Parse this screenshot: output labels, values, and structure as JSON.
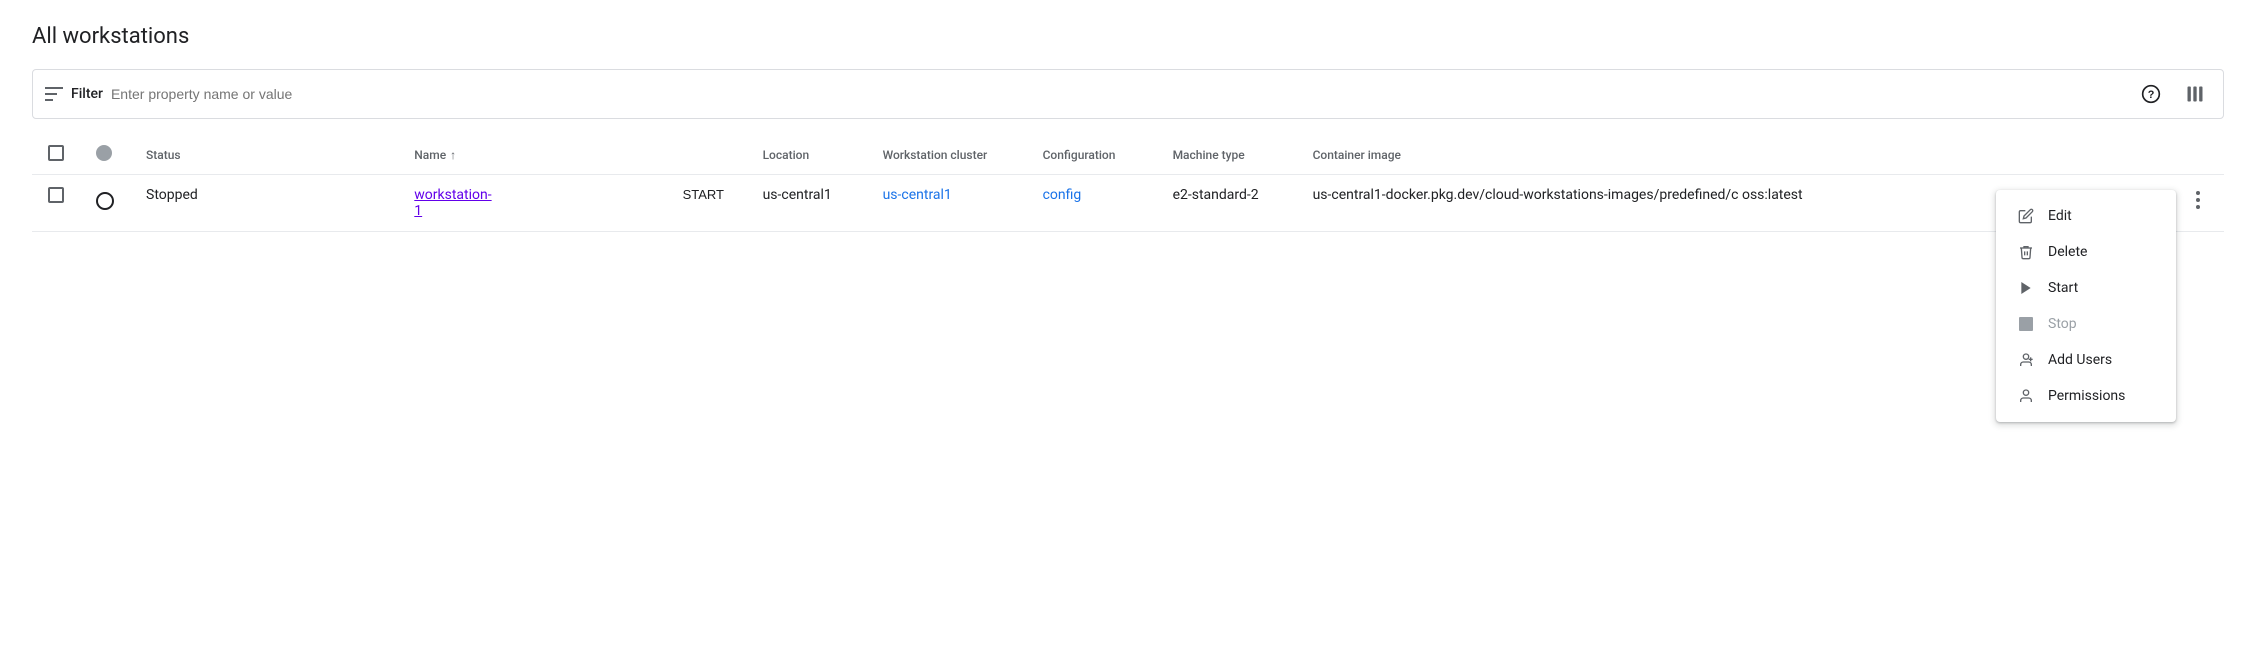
{
  "page": {
    "title": "All workstations"
  },
  "toolbar": {
    "filter_label": "Filter",
    "filter_placeholder": "Enter property name or value"
  },
  "table": {
    "columns": [
      {
        "key": "checkbox",
        "label": ""
      },
      {
        "key": "status_icon",
        "label": ""
      },
      {
        "key": "status",
        "label": "Status"
      },
      {
        "key": "name",
        "label": "Name"
      },
      {
        "key": "action",
        "label": ""
      },
      {
        "key": "location",
        "label": "Location"
      },
      {
        "key": "cluster",
        "label": "Workstation cluster"
      },
      {
        "key": "configuration",
        "label": "Configuration"
      },
      {
        "key": "machine_type",
        "label": "Machine type"
      },
      {
        "key": "container_image",
        "label": "Container image"
      }
    ],
    "rows": [
      {
        "status": "Stopped",
        "name": "workstation-1",
        "action": "START",
        "location": "us-central1",
        "cluster": "us-central1",
        "configuration": "config",
        "machine_type": "e2-standard-2",
        "container_image": "us-central1-docker.pkg.dev/cloud-workstations-images/predefined/c oss:latest"
      }
    ]
  },
  "context_menu": {
    "items": [
      {
        "label": "Edit",
        "icon": "pencil",
        "disabled": false
      },
      {
        "label": "Delete",
        "icon": "trash",
        "disabled": false
      },
      {
        "label": "Start",
        "icon": "play",
        "disabled": false
      },
      {
        "label": "Stop",
        "icon": "stop",
        "disabled": true
      },
      {
        "label": "Add Users",
        "icon": "person-add",
        "disabled": false
      },
      {
        "label": "Permissions",
        "icon": "person",
        "disabled": false
      }
    ]
  },
  "icons": {
    "help": "❓",
    "columns": "|||",
    "filter": "☰",
    "more": "⋮"
  }
}
